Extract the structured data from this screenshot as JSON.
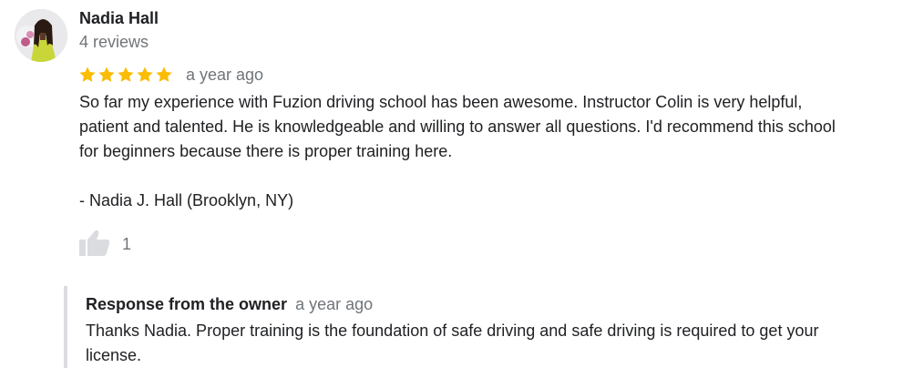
{
  "review": {
    "author_name": "Nadia Hall",
    "author_reviews": "4 reviews",
    "rating": 5,
    "star_color": "#fbbc04",
    "time": "a year ago",
    "text_lines": [
      "So far my experience with Fuzion driving school has been awesome. Instructor Colin is very helpful,",
      "patient and talented. He is knowledgeable and willing to answer all questions. I'd recommend this school",
      "for beginners because there is proper training here."
    ],
    "signature": "- Nadia J. Hall (Brooklyn, NY)",
    "likes": "1"
  },
  "owner_response": {
    "title": "Response from the owner",
    "time": "a year ago",
    "text_lines": [
      "Thanks Nadia. Proper training is the foundation of safe driving and safe driving is required to get your",
      "license."
    ]
  }
}
